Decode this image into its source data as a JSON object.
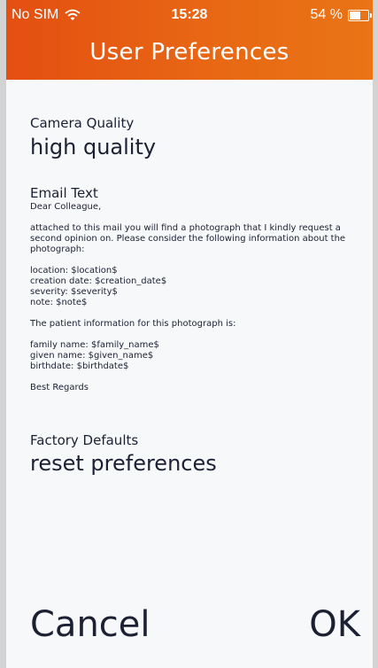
{
  "status_bar": {
    "carrier": "No SIM",
    "time": "15:28",
    "battery": "54 %",
    "battery_level": 0.54
  },
  "header": {
    "title": "User Preferences"
  },
  "camera_quality": {
    "label": "Camera Quality",
    "value": "high quality"
  },
  "email_text": {
    "label": "Email Text",
    "paragraphs": [
      "Dear Colleague,",
      "attached to this mail you will find a photograph that I kindly request a second opinion on. Please consider the following information about the photograph:",
      "location: $location$\ncreation date: $creation_date$\nseverity: $severity$\nnote: $note$",
      "The patient information for this photograph is:",
      "family name: $family_name$\ngiven name: $given_name$\nbirthdate: $birthdate$",
      "Best Regards"
    ]
  },
  "factory_defaults": {
    "label": "Factory Defaults",
    "value": "reset preferences"
  },
  "footer": {
    "cancel_label": "Cancel",
    "ok_label": "OK"
  },
  "colors": {
    "header_start": "#e44f12",
    "header_end": "#ea7416",
    "text": "#1c2033",
    "background": "#f7f8fa"
  }
}
